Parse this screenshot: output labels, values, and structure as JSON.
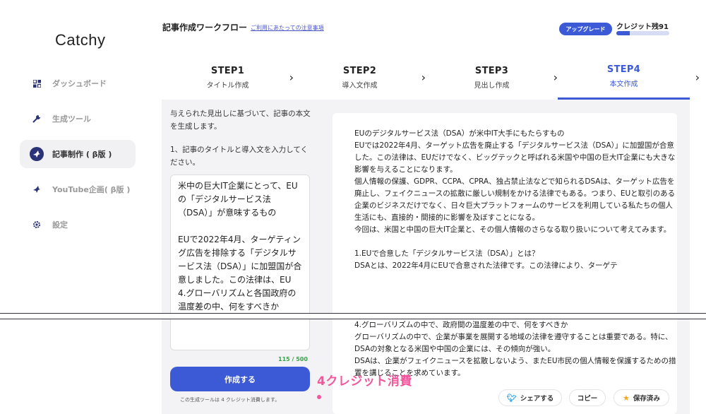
{
  "app": {
    "logo": "Catchy"
  },
  "header": {
    "title": "記事作成ワークフロー",
    "notice_link": "ご利用にあたっての注意事項",
    "upgrade_label": "アップグレード",
    "credit_label": "クレジット残91",
    "credit_fill_fraction": 0.25
  },
  "sidebar": {
    "items": [
      {
        "label": "ダッシュボード",
        "icon": "dashboard-icon",
        "active": false
      },
      {
        "label": "生成ツール",
        "icon": "wrench-icon",
        "active": false
      },
      {
        "label": "記事制作 ( β版 )",
        "icon": "bird-icon",
        "active": true
      },
      {
        "label": "YouTube企画( β版 )",
        "icon": "bird-icon",
        "active": false
      },
      {
        "label": "設定",
        "icon": "gear-icon",
        "active": false
      }
    ]
  },
  "steps": [
    {
      "num": "STEP1",
      "name": "タイトル作成",
      "active": false
    },
    {
      "num": "STEP2",
      "name": "導入文作成",
      "active": false
    },
    {
      "num": "STEP3",
      "name": "見出し作成",
      "active": false
    },
    {
      "num": "STEP4",
      "name": "本文作成",
      "active": true
    }
  ],
  "form": {
    "instruction_1": "与えられた見出しに基づいて、記事の本文を生成します。",
    "instruction_2": "1、記事のタイトルと導入文を入力してください。",
    "textarea_value": "米中の巨大IT企業にとって、EUの「デジタルサービス法（DSA）」が意味するもの\n\nEUで2022年4月、ターゲティング広告を排除する「デジタルサービス法（DSA）」に加盟国が合意しました。この法律は、EU\n4.グローバリズムと各国政府の温度差の中、何をすべきか",
    "counter": "115 / 500",
    "generate_button": "作成する",
    "note": "この生成ツールは 4 クレジット消費します。"
  },
  "output": {
    "paragraphs": [
      "EUのデジタルサービス法（DSA）が米中IT大手にもたらすもの\nEUでは2022年4月、ターゲット広告を廃止する「デジタルサービス法（DSA）」に加盟国が合意した。この法律は、EUだけでなく、ビッグテックと呼ばれる米国や中国の巨大IT企業にも大きな影響を与えることになります。\n個人情報の保護、GDPR、CCPA、CPRA、独占禁止法などで知られるDSAは、ターゲット広告を廃止し、フェイクニュースの拡散に厳しい規制をかける法律でもある。つまり、EUと取引のある企業のビジネスだけでなく、日々巨大プラットフォームのサービスを利用している私たちの個人生活にも、直接的・間接的に影響を及ぼすことになる。\n今回は、米国と中国の巨大IT企業と、その個人情報のさらなる取り扱いについて考えてみます。\n\n1.EUで合意した「デジタルサービス法（DSA）」とは？\nDSAとは、2022年4月にEUで合意された法律です。この法律により、ターゲテ",
      "4.グローバリズムの中で、政府間の温度差の中で、何をすべきか\nグローバリズムの中で、企業が事業を展開する地域の法律を遵守することは重要である。特に、DSAの対象となる米国や中国の企業には、その傾向が強い。\nDSAは、企業がフェイクニュースを拡散しないよう、またEU市民の個人情報を保護するための措置を講じることを求めています。"
    ]
  },
  "actions": {
    "share": "シェアする",
    "copy": "コピー",
    "saved": "保存済み"
  },
  "annotation": "4クレジット消費",
  "colors": {
    "accent": "#3c5ad6",
    "annotation": "#f3569c",
    "counter": "#3aa04a"
  }
}
